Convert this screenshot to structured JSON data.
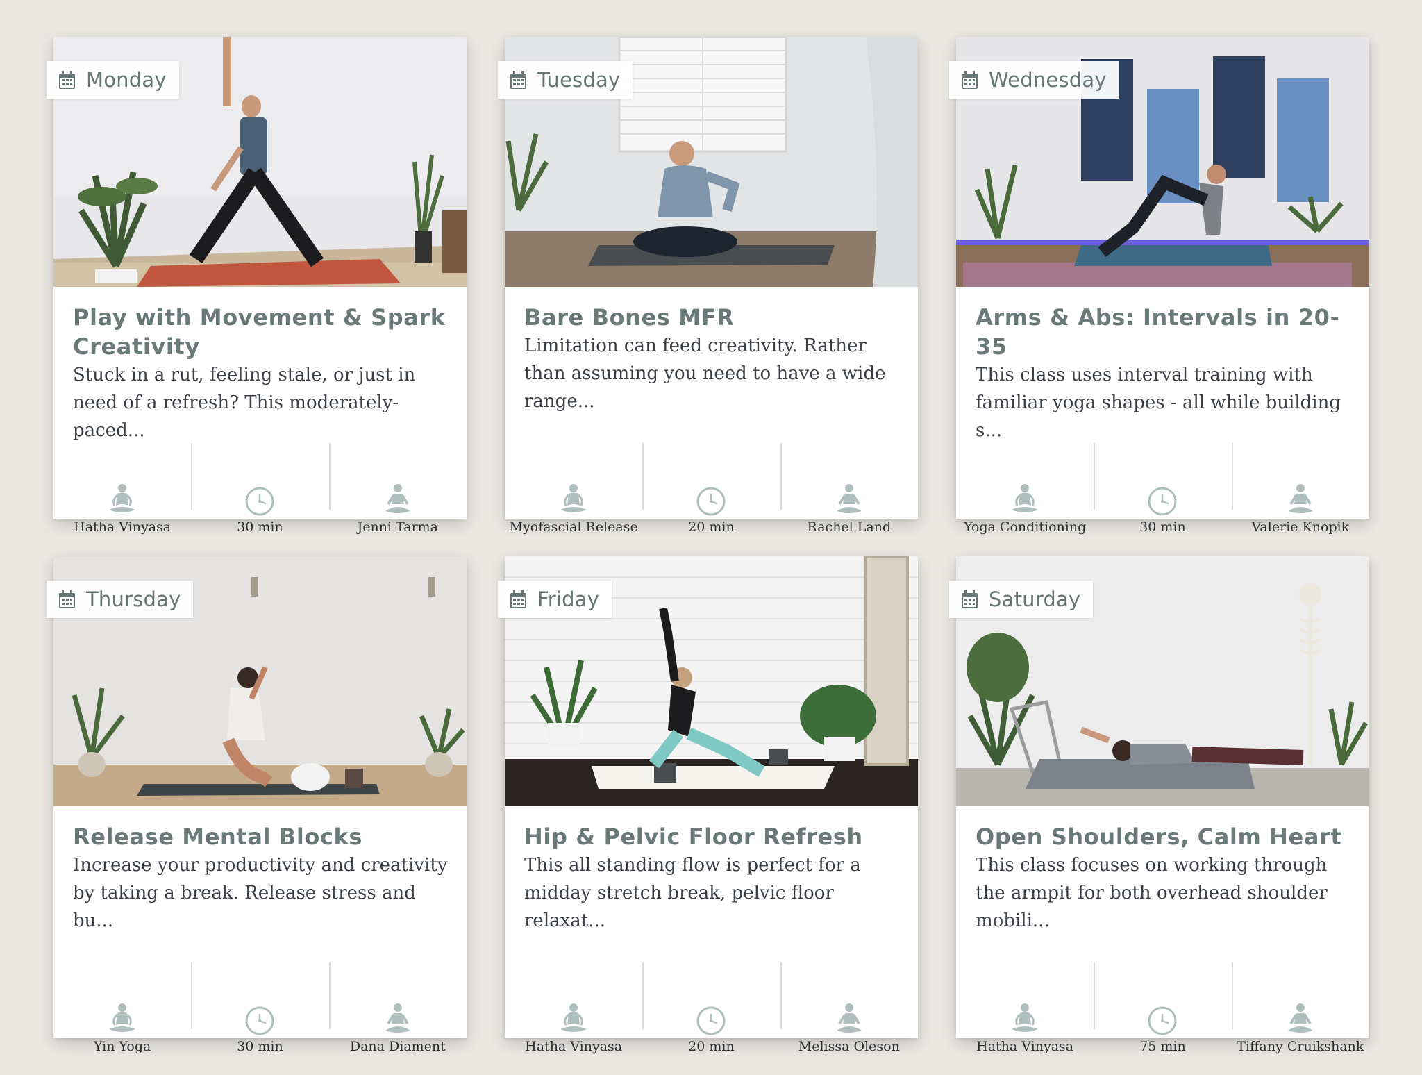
{
  "colors": {
    "accent": "#6a7a78",
    "icon": "#aebfbd",
    "background": "#ebe8e3"
  },
  "icons": {
    "badge": "calendar-icon",
    "style": "lotus-icon",
    "duration": "clock-icon",
    "teacher": "meditation-figure-icon"
  },
  "cards": [
    {
      "day": "Monday",
      "title": "Play with Movement & Spark Creativity",
      "description": "Stuck in a rut, feeling stale, or just in need of a refresh? This moderately-paced...",
      "style": "Hatha Vinyasa",
      "duration": "30 min",
      "teacher": "Jenni Tarma"
    },
    {
      "day": "Tuesday",
      "title": "Bare Bones MFR",
      "description": "Limitation can feed creativity. Rather than assuming you need to have a wide range...",
      "style": "Myofascial Release",
      "duration": "20 min",
      "teacher": "Rachel Land"
    },
    {
      "day": "Wednesday",
      "title": "Arms & Abs: Intervals in 20-35",
      "description": "This class uses interval training with familiar yoga shapes - all while building s...",
      "style": "Yoga Conditioning",
      "duration": "30 min",
      "teacher": "Valerie Knopik"
    },
    {
      "day": "Thursday",
      "title": "Release Mental Blocks",
      "description": "Increase your productivity and creativity by taking a break. Release stress and bu...",
      "style": "Yin Yoga",
      "duration": "30 min",
      "teacher": "Dana Diament"
    },
    {
      "day": "Friday",
      "title": "Hip & Pelvic Floor Refresh",
      "description": "This all standing flow is perfect for a midday stretch break, pelvic floor relaxat...",
      "style": "Hatha Vinyasa",
      "duration": "20 min",
      "teacher": "Melissa Oleson"
    },
    {
      "day": "Saturday",
      "title": "Open Shoulders, Calm Heart",
      "description": "This class focuses on working through the armpit for both overhead shoulder mobili...",
      "style": "Hatha Vinyasa",
      "duration": "75 min",
      "teacher": "Tiffany Cruikshank"
    }
  ]
}
